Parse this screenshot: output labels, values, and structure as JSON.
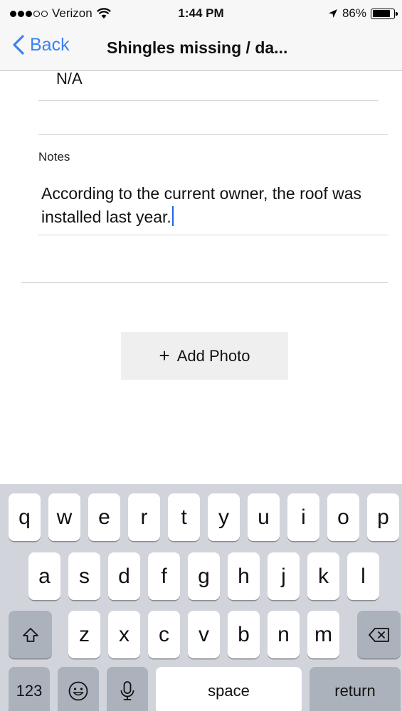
{
  "status_bar": {
    "carrier": "Verizon",
    "time": "1:44 PM",
    "battery": "86%",
    "battery_level": 0.86,
    "signal_bars_filled": 3,
    "signal_bars_total": 5
  },
  "nav": {
    "back_label": "Back",
    "title": "Shingles missing / da..."
  },
  "form": {
    "previous_value": "N/A",
    "notes_label": "Notes",
    "notes_value": "According to the current owner, the roof was installed last year."
  },
  "add_photo": {
    "plus": "+",
    "label": "Add Photo"
  },
  "keyboard": {
    "row1": [
      "q",
      "w",
      "e",
      "r",
      "t",
      "y",
      "u",
      "i",
      "o",
      "p"
    ],
    "row2": [
      "a",
      "s",
      "d",
      "f",
      "g",
      "h",
      "j",
      "k",
      "l"
    ],
    "row3": [
      "z",
      "x",
      "c",
      "v",
      "b",
      "n",
      "m"
    ],
    "numbers_label": "123",
    "space_label": "space",
    "return_label": "return",
    "icons": [
      "shift-icon",
      "backspace-icon",
      "emoji-icon",
      "microphone-icon"
    ]
  },
  "colors": {
    "accent": "#3b82f6",
    "caret": "#2563eb",
    "keyboard_bg": "#d1d4db",
    "dark_key": "#acb2bc"
  }
}
